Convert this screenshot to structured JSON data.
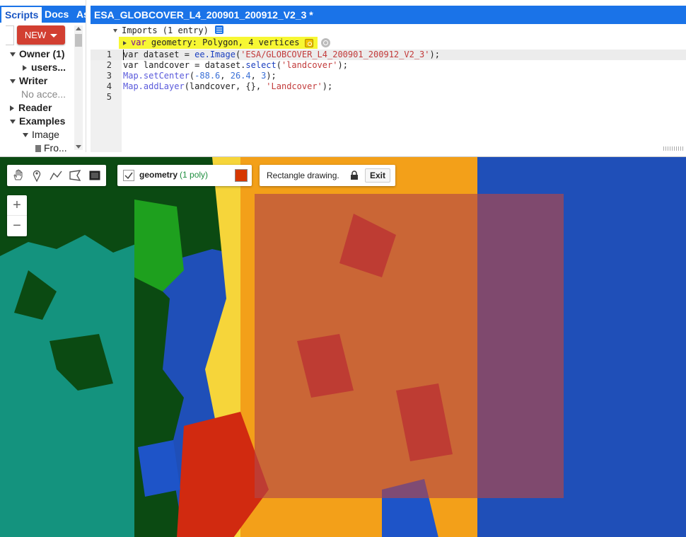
{
  "left_panel": {
    "tabs": [
      "Scripts",
      "Docs",
      "As"
    ],
    "new_button_label": "NEW",
    "tree": [
      {
        "label": "Owner",
        "count": "(1)"
      },
      {
        "label": "users..."
      },
      {
        "label": "Writer"
      },
      {
        "label": "No acce..."
      },
      {
        "label": "Reader"
      },
      {
        "label": "Examples"
      },
      {
        "label": "Image"
      },
      {
        "label": "Fro..."
      }
    ]
  },
  "editor": {
    "tab_title": "ESA_GLOBCOVER_L4_200901_200912_V2_3 *",
    "imports_header": "Imports (1 entry)",
    "geometry_import": {
      "keyword": "var",
      "name": "geometry",
      "desc": ": Polygon, 4 vertices"
    },
    "line_numbers": [
      "1",
      "2",
      "3",
      "4",
      "5"
    ],
    "code": {
      "l1": {
        "a": "var dataset = ",
        "b": "ee.Image",
        "c": "(",
        "d": "'ESA/GLOBCOVER_L4_200901_200912_V2_3'",
        "e": ");"
      },
      "l2": {
        "a": "var landcover = dataset.",
        "b": "select",
        "c": "(",
        "d": "'landcover'",
        "e": ");"
      },
      "l3": {
        "a": "Map.setCenter",
        "b": "(",
        "c": "-88.6",
        "d": ", ",
        "e": "26.4",
        "f": ", ",
        "g": "3",
        "h": ");"
      },
      "l4": {
        "a": "Map.addLayer",
        "b": "(landcover, {}, ",
        "c": "'Landcover'",
        "d": ");"
      }
    }
  },
  "map": {
    "drawing_tools": [
      "hand-tool",
      "point-tool",
      "line-tool",
      "polygon-tool",
      "rectangle-tool"
    ],
    "geometry_layer": {
      "name": "geometry",
      "count": "(1 poly)",
      "color": "#d63800"
    },
    "drawing_status": "Rectangle drawing.",
    "exit_label": "Exit",
    "zoom_in": "+",
    "zoom_out": "−",
    "colors": {
      "ocean": "#1f4fb8",
      "water_teal": "#14937e",
      "forest_dark": "#0b4a12",
      "forest_green": "#1ea01e",
      "crop_yellow": "#f6d53a",
      "crop_orange": "#f3a019",
      "urban_red": "#d12a10",
      "rect_overlay": "rgba(180,70,70,0.65)"
    }
  }
}
